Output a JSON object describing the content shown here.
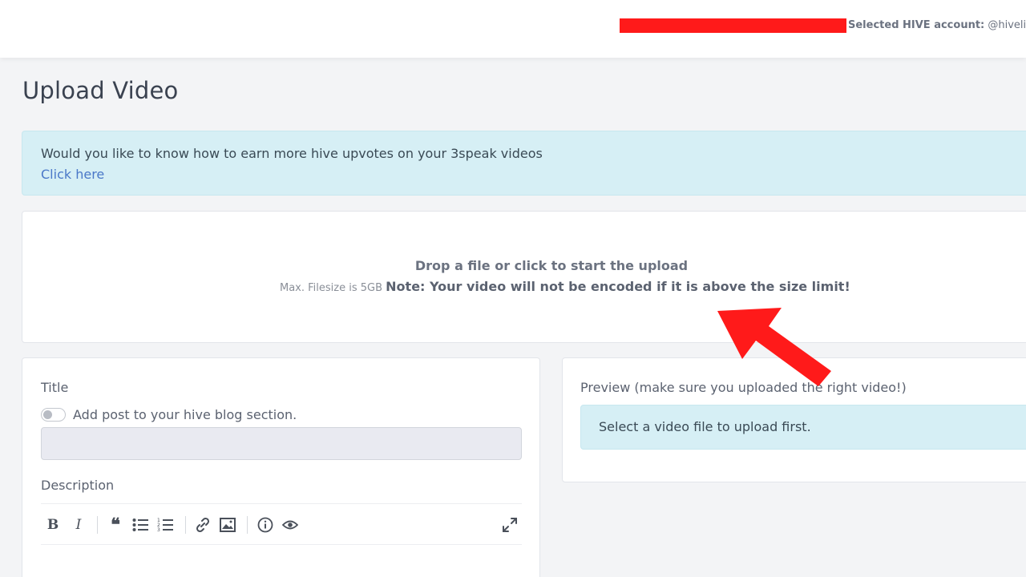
{
  "header": {
    "account_label": "Selected HIVE account:",
    "account_value": "@hivelingo",
    "redaction_color": "#ff1a1a"
  },
  "page": {
    "title": "Upload Video"
  },
  "alert": {
    "text": "Would you like to know how to earn more hive upvotes on your 3speak videos",
    "link": "Click here"
  },
  "dropzone": {
    "title": "Drop a file or click to start the upload",
    "max_size": "Max. Filesize is 5GB",
    "note": "Note: Your video will not be encoded if it is above the size limit!"
  },
  "form": {
    "title_label": "Title",
    "blog_toggle_label": "Add post to your hive blog section.",
    "title_value": "",
    "description_label": "Description",
    "toolbar_icons": [
      "bold-icon",
      "italic-icon",
      "quote-icon",
      "unordered-list-icon",
      "ordered-list-icon",
      "link-icon",
      "image-icon",
      "guide-icon",
      "preview-icon",
      "fullscreen-icon"
    ]
  },
  "preview": {
    "label": "Preview (make sure you uploaded the right video!)",
    "message": "Select a video file to upload first."
  },
  "colors": {
    "accent": "#4a78c8",
    "info_bg": "#d6eff5",
    "annotation_arrow": "#ff1a1a"
  }
}
